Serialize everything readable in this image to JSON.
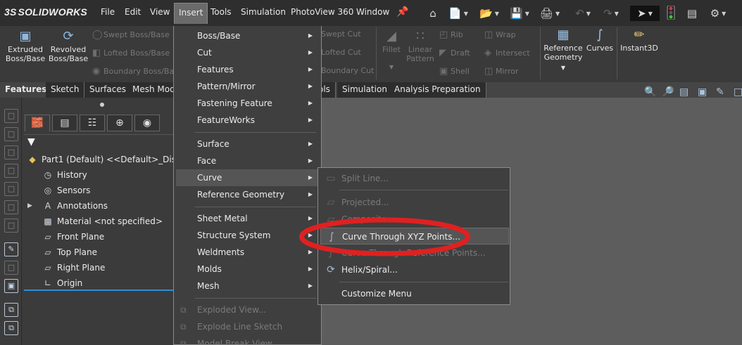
{
  "app": {
    "logo_text": "SOLIDWORKS",
    "logo_mark": "3S"
  },
  "menubar": {
    "items": [
      "File",
      "Edit",
      "View",
      "Insert",
      "Tools",
      "Simulation",
      "PhotoView 360",
      "Window"
    ],
    "active": "Insert"
  },
  "commands": {
    "extruded": "Extruded\nBoss/Base",
    "revolved": "Revolved\nBoss/Base",
    "swept_boss": "Swept Boss/Base",
    "lofted_boss": "Lofted Boss/Base",
    "boundary_boss": "Boundary Boss/Ba",
    "swept_cut": "Swept Cut",
    "lofted_cut": "Lofted Cut",
    "boundary_cut": "Boundary Cut",
    "fillet": "Fillet",
    "linear_pattern": "Linear\nPattern",
    "rib": "Rib",
    "draft": "Draft",
    "shell": "Shell",
    "wrap": "Wrap",
    "intersect": "Intersect",
    "mirror": "Mirror",
    "reference_geometry": "Reference\nGeometry",
    "curves": "Curves",
    "instant3d": "Instant3D"
  },
  "tabs": {
    "features": "Features",
    "sketch": "Sketch",
    "surfaces": "Surfaces",
    "mesh_mod": "Mesh Mod",
    "tools_partial": "ols",
    "simulation": "Simulation",
    "analysis": "Analysis Preparation"
  },
  "tree": {
    "root": "Part1 (Default) <<Default>_Dis",
    "items": [
      "History",
      "Sensors",
      "Annotations",
      "Material <not specified>",
      "Front Plane",
      "Top Plane",
      "Right Plane",
      "Origin"
    ]
  },
  "insert_menu": {
    "items": [
      "Boss/Base",
      "Cut",
      "Features",
      "Pattern/Mirror",
      "Fastening Feature",
      "FeatureWorks",
      "Surface",
      "Face",
      "Curve",
      "Reference Geometry",
      "Sheet Metal",
      "Structure System",
      "Weldments",
      "Molds",
      "Mesh",
      "Exploded View...",
      "Explode Line Sketch",
      "Model Break View"
    ],
    "highlighted": "Curve"
  },
  "curve_menu": {
    "items": [
      "Split Line...",
      "Projected...",
      "Composite...",
      "Curve Through XYZ Points...",
      "Curve Through Reference Points...",
      "Helix/Spiral...",
      "Customize Menu"
    ],
    "highlighted": "Curve Through XYZ Points..."
  },
  "colors": {
    "annotation_circle": "#e02020",
    "menubar_bg": "#2e2e2e",
    "viewport_bg": "#5d5d5d",
    "tree_underline": "#2a8fd6"
  }
}
